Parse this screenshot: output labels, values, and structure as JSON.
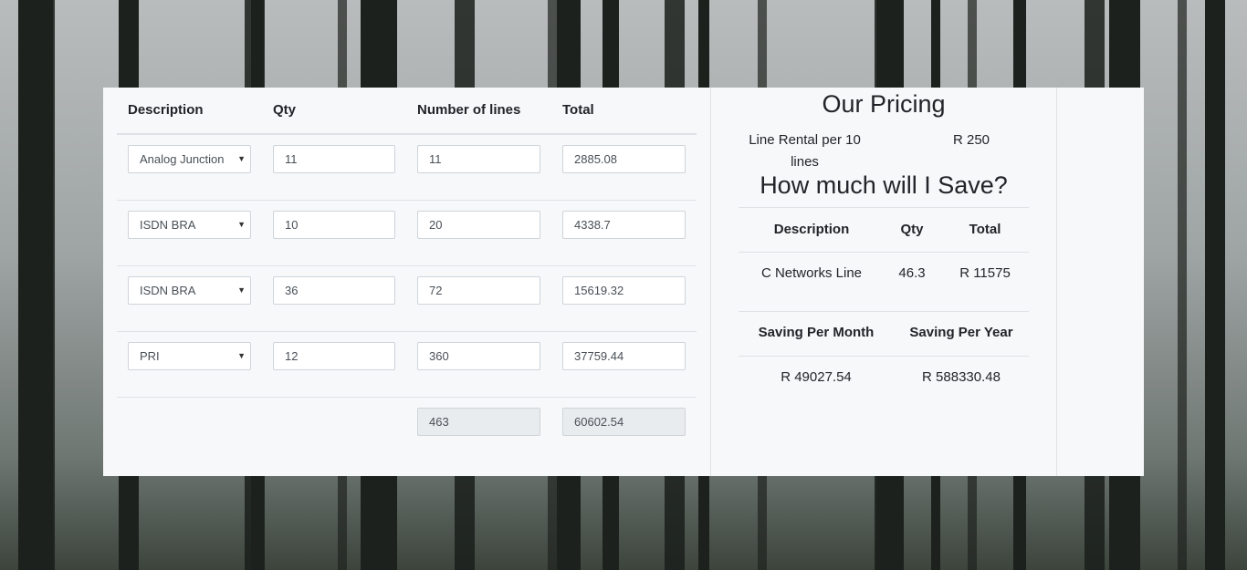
{
  "table": {
    "headers": {
      "description": "Description",
      "qty": "Qty",
      "lines": "Number of lines",
      "total": "Total"
    },
    "rows": [
      {
        "description": "Analog Junction",
        "qty": "11",
        "lines": "11",
        "total": "2885.08"
      },
      {
        "description": "ISDN BRA",
        "qty": "10",
        "lines": "20",
        "total": "4338.7"
      },
      {
        "description": "ISDN BRA",
        "qty": "36",
        "lines": "72",
        "total": "15619.32"
      },
      {
        "description": "PRI",
        "qty": "12",
        "lines": "360",
        "total": "37759.44"
      }
    ],
    "totals": {
      "lines": "463",
      "total": "60602.54"
    }
  },
  "pricing": {
    "title": "Our Pricing",
    "rental_label": "Line Rental per 10 lines",
    "rental_value": "R 250"
  },
  "savings": {
    "title": "How much will I Save?",
    "headers": {
      "description": "Description",
      "qty": "Qty",
      "total": "Total"
    },
    "row": {
      "description": "C Networks Line",
      "qty": "46.3",
      "total": "R 11575"
    },
    "saving_headers": {
      "month": "Saving Per Month",
      "year": "Saving Per Year"
    },
    "saving_values": {
      "month": "R 49027.54",
      "year": "R 588330.48"
    }
  }
}
